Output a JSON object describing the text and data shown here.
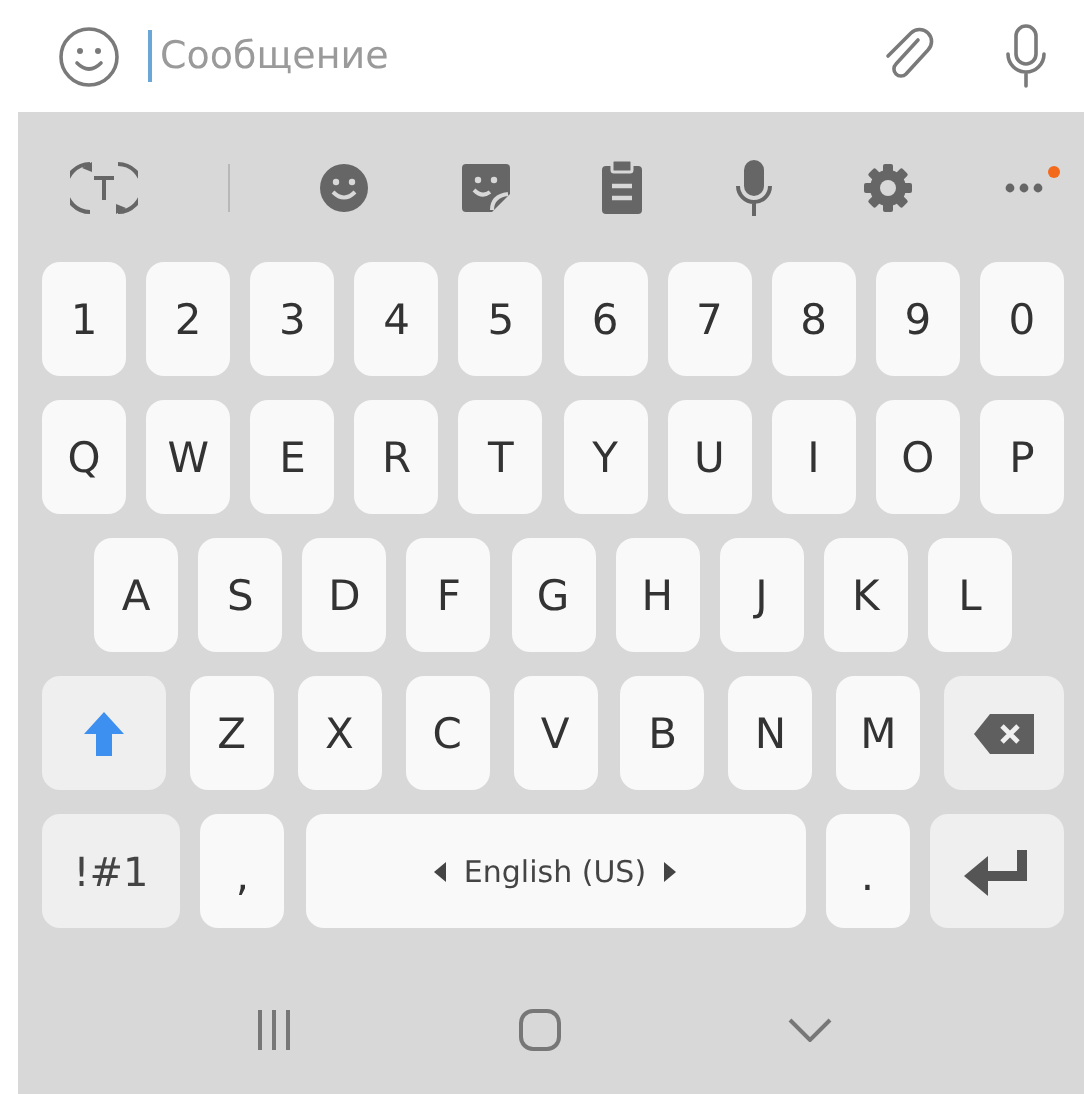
{
  "message_bar": {
    "placeholder": "Сообщение",
    "focused": true
  },
  "toolbar": {
    "more_badge": true
  },
  "keyboard": {
    "rows": [
      {
        "keys": [
          {
            "kind": "char",
            "label": "1"
          },
          {
            "kind": "char",
            "label": "2"
          },
          {
            "kind": "char",
            "label": "3"
          },
          {
            "kind": "char",
            "label": "4"
          },
          {
            "kind": "char",
            "label": "5"
          },
          {
            "kind": "char",
            "label": "6"
          },
          {
            "kind": "char",
            "label": "7"
          },
          {
            "kind": "char",
            "label": "8"
          },
          {
            "kind": "char",
            "label": "9"
          },
          {
            "kind": "char",
            "label": "0"
          }
        ]
      },
      {
        "keys": [
          {
            "kind": "char",
            "label": "Q"
          },
          {
            "kind": "char",
            "label": "W"
          },
          {
            "kind": "char",
            "label": "E"
          },
          {
            "kind": "char",
            "label": "R"
          },
          {
            "kind": "char",
            "label": "T"
          },
          {
            "kind": "char",
            "label": "Y"
          },
          {
            "kind": "char",
            "label": "U"
          },
          {
            "kind": "char",
            "label": "I"
          },
          {
            "kind": "char",
            "label": "O"
          },
          {
            "kind": "char",
            "label": "P"
          }
        ]
      },
      {
        "keys": [
          {
            "kind": "char",
            "label": "A"
          },
          {
            "kind": "char",
            "label": "S"
          },
          {
            "kind": "char",
            "label": "D"
          },
          {
            "kind": "char",
            "label": "F"
          },
          {
            "kind": "char",
            "label": "G"
          },
          {
            "kind": "char",
            "label": "H"
          },
          {
            "kind": "char",
            "label": "J"
          },
          {
            "kind": "char",
            "label": "K"
          },
          {
            "kind": "char",
            "label": "L"
          }
        ]
      },
      {
        "keys": [
          {
            "kind": "shift",
            "on": true
          },
          {
            "kind": "char",
            "label": "Z"
          },
          {
            "kind": "char",
            "label": "X"
          },
          {
            "kind": "char",
            "label": "C"
          },
          {
            "kind": "char",
            "label": "V"
          },
          {
            "kind": "char",
            "label": "B"
          },
          {
            "kind": "char",
            "label": "N"
          },
          {
            "kind": "char",
            "label": "M"
          },
          {
            "kind": "backspace"
          }
        ]
      },
      {
        "keys": [
          {
            "kind": "symbols",
            "label": "!#1"
          },
          {
            "kind": "punct",
            "label": ","
          },
          {
            "kind": "space",
            "label": "English (US)"
          },
          {
            "kind": "punct",
            "label": "."
          },
          {
            "kind": "enter"
          }
        ]
      }
    ]
  }
}
